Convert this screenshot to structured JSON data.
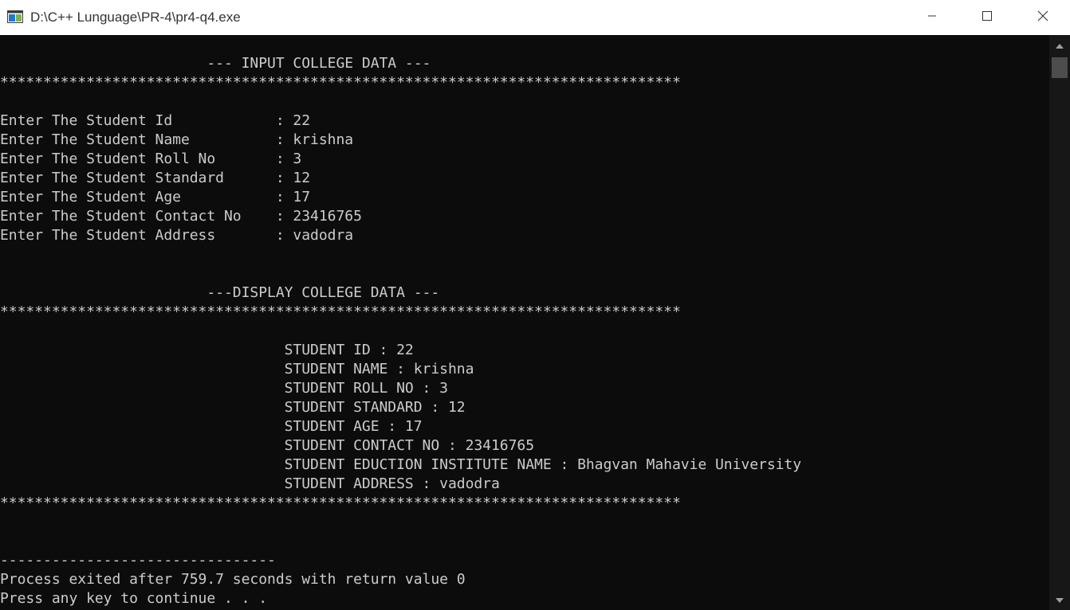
{
  "window": {
    "title": "D:\\C++ Lunguage\\PR-4\\pr4-q4.exe",
    "icon": "console-app-icon",
    "controls": [
      "minimize-icon",
      "maximize-icon",
      "close-icon"
    ]
  },
  "console": {
    "lines": [
      "                        --- INPUT COLLEGE DATA ---",
      "*******************************************************************************",
      "",
      "Enter The Student Id            : 22",
      "Enter The Student Name          : krishna",
      "Enter The Student Roll No       : 3",
      "Enter The Student Standard      : 12",
      "Enter The Student Age           : 17",
      "Enter The Student Contact No    : 23416765",
      "Enter The Student Address       : vadodra",
      "",
      "",
      "                        ---DISPLAY COLLEGE DATA ---",
      "*******************************************************************************",
      "",
      "                                 STUDENT ID : 22",
      "                                 STUDENT NAME : krishna",
      "                                 STUDENT ROLL NO : 3",
      "                                 STUDENT STANDARD : 12",
      "                                 STUDENT AGE : 17",
      "                                 STUDENT CONTACT NO : 23416765",
      "                                 STUDENT EDUCTION INSTITUTE NAME : Bhagvan Mahavie University",
      "                                 STUDENT ADDRESS : vadodra",
      "*******************************************************************************",
      "",
      "",
      "--------------------------------",
      "Process exited after 759.7 seconds with return value 0",
      "Press any key to continue . . ."
    ]
  },
  "colors": {
    "background": "#0c0c0c",
    "text": "#cccccc",
    "titlebar": "#ffffff",
    "scroll_thumb": "#4d4d4d"
  }
}
